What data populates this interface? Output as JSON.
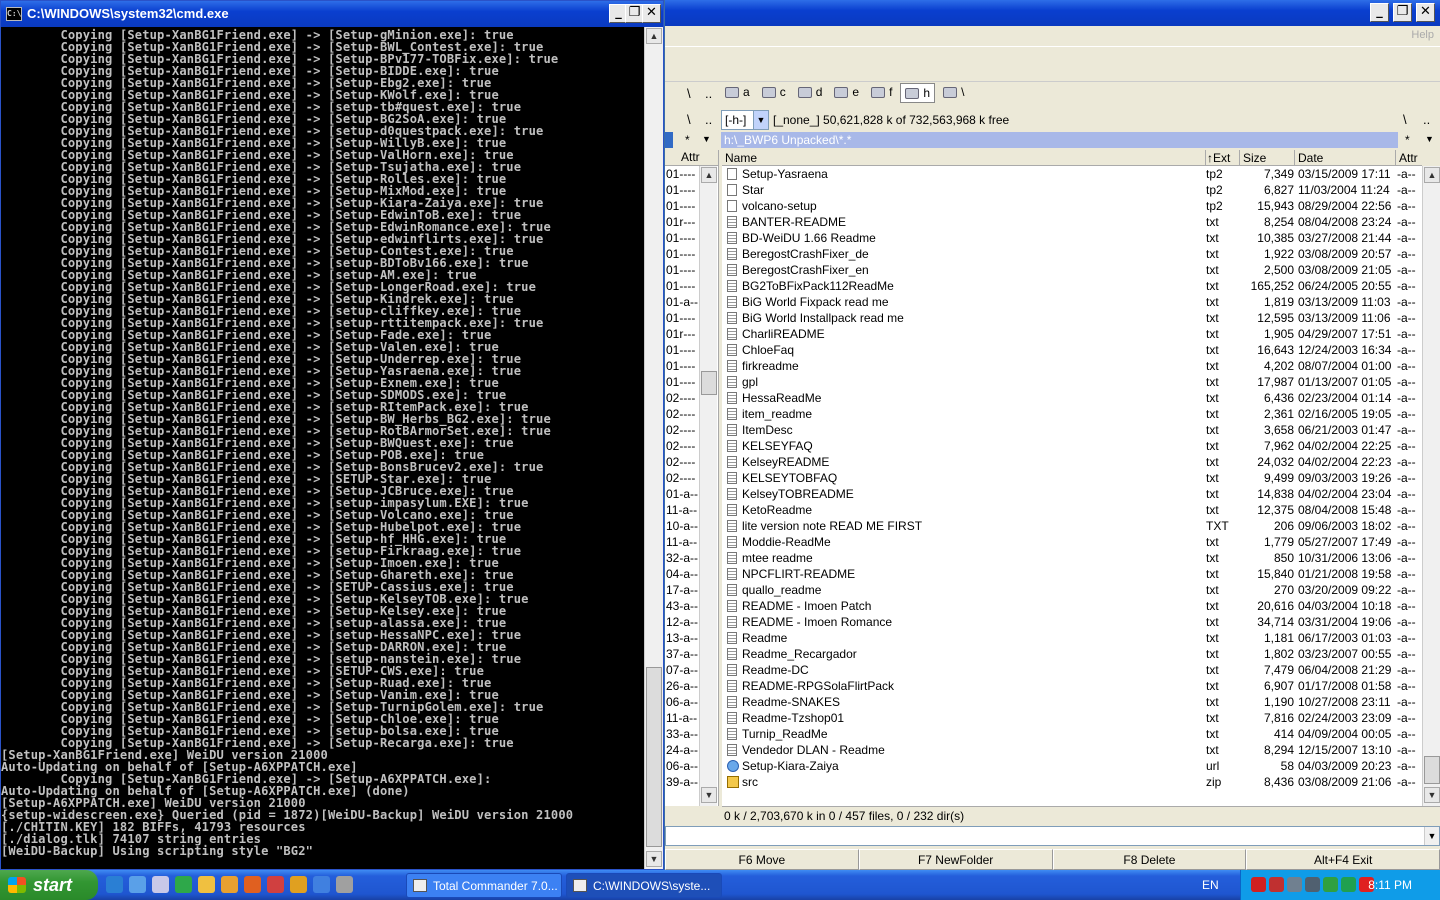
{
  "cmd": {
    "title": "C:\\WINDOWS\\system32\\cmd.exe",
    "lines": [
      "        Copying [Setup-XanBG1Friend.exe] -> [Setup-gMinion.exe]: true",
      "        Copying [Setup-XanBG1Friend.exe] -> [Setup-BWL_Contest.exe]: true",
      "        Copying [Setup-XanBG1Friend.exe] -> [Setup-BPv177-TOBFix.exe]: true",
      "        Copying [Setup-XanBG1Friend.exe] -> [Setup-BIDDE.exe]: true",
      "        Copying [Setup-XanBG1Friend.exe] -> [Setup-Ebg2.exe]: true",
      "        Copying [Setup-XanBG1Friend.exe] -> [Setup-KWolf.exe]: true",
      "        Copying [Setup-XanBG1Friend.exe] -> [setup-tb#quest.exe]: true",
      "        Copying [Setup-XanBG1Friend.exe] -> [Setup-BG2SoA.exe]: true",
      "        Copying [Setup-XanBG1Friend.exe] -> [setup-d0questpack.exe]: true",
      "        Copying [Setup-XanBG1Friend.exe] -> [Setup-WillyB.exe]: true",
      "        Copying [Setup-XanBG1Friend.exe] -> [Setup-ValHorn.exe]: true",
      "        Copying [Setup-XanBG1Friend.exe] -> [Setup-Tsujatha.exe]: true",
      "        Copying [Setup-XanBG1Friend.exe] -> [Setup-Rolles.exe]: true",
      "        Copying [Setup-XanBG1Friend.exe] -> [Setup-MixMod.exe]: true",
      "        Copying [Setup-XanBG1Friend.exe] -> [Setup-Kiara-Zaiya.exe]: true",
      "        Copying [Setup-XanBG1Friend.exe] -> [Setup-EdwinToB.exe]: true",
      "        Copying [Setup-XanBG1Friend.exe] -> [Setup-EdwinRomance.exe]: true",
      "        Copying [Setup-XanBG1Friend.exe] -> [Setup-edwinflirts.exe]: true",
      "        Copying [Setup-XanBG1Friend.exe] -> [Setup-Contest.exe]: true",
      "        Copying [Setup-XanBG1Friend.exe] -> [setup-BDToBv166.exe]: true",
      "        Copying [Setup-XanBG1Friend.exe] -> [setup-AM.exe]: true",
      "        Copying [Setup-XanBG1Friend.exe] -> [Setup-LongerRoad.exe]: true",
      "        Copying [Setup-XanBG1Friend.exe] -> [Setup-Kindrek.exe]: true",
      "        Copying [Setup-XanBG1Friend.exe] -> [setup-cliffkey.exe]: true",
      "        Copying [Setup-XanBG1Friend.exe] -> [setup-rttitempack.exe]: true",
      "        Copying [Setup-XanBG1Friend.exe] -> [Setup-Fade.exe]: true",
      "        Copying [Setup-XanBG1Friend.exe] -> [Setup-Valen.exe]: true",
      "        Copying [Setup-XanBG1Friend.exe] -> [Setup-Underrep.exe]: true",
      "        Copying [Setup-XanBG1Friend.exe] -> [Setup-Yasraena.exe]: true",
      "        Copying [Setup-XanBG1Friend.exe] -> [Setup-Exnem.exe]: true",
      "        Copying [Setup-XanBG1Friend.exe] -> [Setup-SDMODS.exe]: true",
      "        Copying [Setup-XanBG1Friend.exe] -> [setup-RItemPack.exe]: true",
      "        Copying [Setup-XanBG1Friend.exe] -> [Setup-BW_Herbs_BG2.exe]: true",
      "        Copying [Setup-XanBG1Friend.exe] -> [setup-RotBArmorSet.exe]: true",
      "        Copying [Setup-XanBG1Friend.exe] -> [Setup-BWQuest.exe]: true",
      "        Copying [Setup-XanBG1Friend.exe] -> [Setup-POB.exe]: true",
      "        Copying [Setup-XanBG1Friend.exe] -> [Setup-BonsBrucev2.exe]: true",
      "        Copying [Setup-XanBG1Friend.exe] -> [SETUP-Star.exe]: true",
      "        Copying [Setup-XanBG1Friend.exe] -> [Setup-JCBruce.exe]: true",
      "        Copying [Setup-XanBG1Friend.exe] -> [setup-impasylum.EXE]: true",
      "        Copying [Setup-XanBG1Friend.exe] -> [Setup-Volcano.exe]: true",
      "        Copying [Setup-XanBG1Friend.exe] -> [Setup-Hubelpot.exe]: true",
      "        Copying [Setup-XanBG1Friend.exe] -> [Setup-hf_HHG.exe]: true",
      "        Copying [Setup-XanBG1Friend.exe] -> [setup-Firkraag.exe]: true",
      "        Copying [Setup-XanBG1Friend.exe] -> [Setup-Imoen.exe]: true",
      "        Copying [Setup-XanBG1Friend.exe] -> [Setup-Ghareth.exe]: true",
      "        Copying [Setup-XanBG1Friend.exe] -> [SETUP-Cassius.exe]: true",
      "        Copying [Setup-XanBG1Friend.exe] -> [Setup-KelseyTOB.exe]: true",
      "        Copying [Setup-XanBG1Friend.exe] -> [Setup-Kelsey.exe]: true",
      "        Copying [Setup-XanBG1Friend.exe] -> [setup-alassa.exe]: true",
      "        Copying [Setup-XanBG1Friend.exe] -> [setup-HessaNPC.exe]: true",
      "        Copying [Setup-XanBG1Friend.exe] -> [Setup-DARRON.exe]: true",
      "        Copying [Setup-XanBG1Friend.exe] -> [setup-nanstein.exe]: true",
      "        Copying [Setup-XanBG1Friend.exe] -> [SETUP-CWS.exe]: true",
      "        Copying [Setup-XanBG1Friend.exe] -> [Setup-Ruad.exe]: true",
      "        Copying [Setup-XanBG1Friend.exe] -> [Setup-Vanim.exe]: true",
      "        Copying [Setup-XanBG1Friend.exe] -> [Setup-TurnipGolem.exe]: true",
      "        Copying [Setup-XanBG1Friend.exe] -> [Setup-Chloe.exe]: true",
      "        Copying [Setup-XanBG1Friend.exe] -> [setup-bolsa.exe]: true",
      "        Copying [Setup-XanBG1Friend.exe] -> [Setup-Recarga.exe]: true",
      "[Setup-XanBG1Friend.exe] WeiDU version 21000",
      "Auto-Updating on behalf of [Setup-A6XPPATCH.exe]",
      "        Copying [Setup-XanBG1Friend.exe] -> [Setup-A6XPPATCH.exe]:",
      "Auto-Updating on behalf of [Setup-A6XPPATCH.exe] (done)",
      "[Setup-A6XPPATCH.exe] WeiDU version 21000",
      "{setup-widescreen.exe} Queried (pid = 1872)[WeiDU-Backup] WeiDU version 21000",
      "[./CHITIN.KEY] 182 BIFFs, 41793 resources",
      "[./dialog.tlk] 74107 string entries",
      "[WeiDU-Backup] Using scripting style \"BG2\""
    ]
  },
  "tc": {
    "menu_help": "Help",
    "nav_root": "\\",
    "nav_up": "..",
    "drives": [
      {
        "label": "a",
        "icon": "floppy-drive-icon"
      },
      {
        "label": "c",
        "icon": "hard-drive-icon"
      },
      {
        "label": "d",
        "icon": "hard-drive-icon"
      },
      {
        "label": "e",
        "icon": "cd-drive-icon"
      },
      {
        "label": "f",
        "icon": "cd-drive-icon"
      },
      {
        "label": "h",
        "icon": "hard-drive-icon"
      },
      {
        "label": "\\",
        "icon": "network-icon"
      }
    ],
    "active_drive": "h",
    "drive_select": "[-h-]",
    "free_space": "[_none_]  50,621,828 k of 732,563,968 k free",
    "star": "*",
    "path": "h:\\_BWP6 Unpacked\\*.*",
    "left_header": "Attr",
    "left_rows": [
      "01----",
      "01----",
      "01----",
      "01r---",
      "01----",
      "01----",
      "01----",
      "01----",
      "01-a--",
      "01----",
      "01r---",
      "01----",
      "01----",
      "01----",
      "02----",
      "02----",
      "02----",
      "02----",
      "02----",
      "02----",
      "01-a--",
      "11-a--",
      "10-a--",
      "11-a--",
      "32-a--",
      "04-a--",
      "17-a--",
      "43-a--",
      "12-a--",
      "13-a--",
      "37-a--",
      "07-a--",
      "26-a--",
      "06-a--",
      "11-a--",
      "33-a--",
      "24-a--",
      "06-a--",
      "39-a--"
    ],
    "columns": {
      "name": "Name",
      "ext": "↑Ext",
      "size": "Size",
      "date": "Date",
      "attr": "Attr"
    },
    "files": [
      {
        "name": "Setup-Yasraena",
        "ext": "tp2",
        "size": "7,349",
        "date": "03/15/2009 17:11",
        "attr": "-a--",
        "icon": "file-icon"
      },
      {
        "name": "Star",
        "ext": "tp2",
        "size": "6,827",
        "date": "11/03/2004 11:24",
        "attr": "-a--",
        "icon": "file-icon"
      },
      {
        "name": "volcano-setup",
        "ext": "tp2",
        "size": "15,943",
        "date": "08/29/2004 22:56",
        "attr": "-a--",
        "icon": "file-icon"
      },
      {
        "name": "BANTER-README",
        "ext": "txt",
        "size": "8,254",
        "date": "08/04/2008 23:24",
        "attr": "-a--",
        "icon": "text-file-icon"
      },
      {
        "name": "BD-WeiDU 1.66 Readme",
        "ext": "txt",
        "size": "10,385",
        "date": "03/27/2008 21:44",
        "attr": "-a--",
        "icon": "text-file-icon"
      },
      {
        "name": "BeregostCrashFixer_de",
        "ext": "txt",
        "size": "1,922",
        "date": "03/08/2009 20:57",
        "attr": "-a--",
        "icon": "text-file-icon"
      },
      {
        "name": "BeregostCrashFixer_en",
        "ext": "txt",
        "size": "2,500",
        "date": "03/08/2009 21:05",
        "attr": "-a--",
        "icon": "text-file-icon"
      },
      {
        "name": "BG2ToBFixPack112ReadMe",
        "ext": "txt",
        "size": "165,252",
        "date": "06/24/2005 20:55",
        "attr": "-a--",
        "icon": "text-file-icon"
      },
      {
        "name": "BiG World Fixpack read me",
        "ext": "txt",
        "size": "1,819",
        "date": "03/13/2009 11:03",
        "attr": "-a--",
        "icon": "text-file-icon"
      },
      {
        "name": "BiG World Installpack read me",
        "ext": "txt",
        "size": "12,595",
        "date": "03/13/2009 11:06",
        "attr": "-a--",
        "icon": "text-file-icon"
      },
      {
        "name": "CharliREADME",
        "ext": "txt",
        "size": "1,905",
        "date": "04/29/2007 17:51",
        "attr": "-a--",
        "icon": "text-file-icon"
      },
      {
        "name": "ChloeFaq",
        "ext": "txt",
        "size": "16,643",
        "date": "12/24/2003 16:34",
        "attr": "-a--",
        "icon": "text-file-icon"
      },
      {
        "name": "firkreadme",
        "ext": "txt",
        "size": "4,202",
        "date": "08/07/2004 01:00",
        "attr": "-a--",
        "icon": "text-file-icon"
      },
      {
        "name": "gpl",
        "ext": "txt",
        "size": "17,987",
        "date": "01/13/2007 01:05",
        "attr": "-a--",
        "icon": "text-file-icon"
      },
      {
        "name": "HessaReadMe",
        "ext": "txt",
        "size": "6,436",
        "date": "02/23/2004 01:14",
        "attr": "-a--",
        "icon": "text-file-icon"
      },
      {
        "name": "item_readme",
        "ext": "txt",
        "size": "2,361",
        "date": "02/16/2005 19:05",
        "attr": "-a--",
        "icon": "text-file-icon"
      },
      {
        "name": "ItemDesc",
        "ext": "txt",
        "size": "3,658",
        "date": "06/21/2003 01:47",
        "attr": "-a--",
        "icon": "text-file-icon"
      },
      {
        "name": "KELSEYFAQ",
        "ext": "txt",
        "size": "7,962",
        "date": "04/02/2004 22:25",
        "attr": "-a--",
        "icon": "text-file-icon"
      },
      {
        "name": "KelseyREADME",
        "ext": "txt",
        "size": "24,032",
        "date": "04/02/2004 22:23",
        "attr": "-a--",
        "icon": "text-file-icon"
      },
      {
        "name": "KELSEYTOBFAQ",
        "ext": "txt",
        "size": "9,499",
        "date": "09/03/2003 19:26",
        "attr": "-a--",
        "icon": "text-file-icon"
      },
      {
        "name": "KelseyTOBREADME",
        "ext": "txt",
        "size": "14,838",
        "date": "04/02/2004 23:04",
        "attr": "-a--",
        "icon": "text-file-icon"
      },
      {
        "name": "KetoReadme",
        "ext": "txt",
        "size": "12,375",
        "date": "08/04/2008 15:48",
        "attr": "-a--",
        "icon": "text-file-icon"
      },
      {
        "name": "lite version note READ ME FIRST",
        "ext": "TXT",
        "size": "206",
        "date": "09/06/2003 18:02",
        "attr": "-a--",
        "icon": "text-file-icon"
      },
      {
        "name": "Moddie-ReadMe",
        "ext": "txt",
        "size": "1,779",
        "date": "05/27/2007 17:49",
        "attr": "-a--",
        "icon": "text-file-icon"
      },
      {
        "name": "mtee readme",
        "ext": "txt",
        "size": "850",
        "date": "10/31/2006 13:06",
        "attr": "-a--",
        "icon": "text-file-icon"
      },
      {
        "name": "NPCFLIRT-README",
        "ext": "txt",
        "size": "15,840",
        "date": "01/21/2008 19:58",
        "attr": "-a--",
        "icon": "text-file-icon"
      },
      {
        "name": "quallo_readme",
        "ext": "txt",
        "size": "270",
        "date": "03/20/2009 09:22",
        "attr": "-a--",
        "icon": "text-file-icon"
      },
      {
        "name": "README - Imoen Patch",
        "ext": "txt",
        "size": "20,616",
        "date": "04/03/2004 10:18",
        "attr": "-a--",
        "icon": "text-file-icon"
      },
      {
        "name": "README - Imoen Romance",
        "ext": "txt",
        "size": "34,714",
        "date": "03/31/2004 19:06",
        "attr": "-a--",
        "icon": "text-file-icon"
      },
      {
        "name": "Readme",
        "ext": "txt",
        "size": "1,181",
        "date": "06/17/2003 01:03",
        "attr": "-a--",
        "icon": "text-file-icon"
      },
      {
        "name": "Readme_Recargador",
        "ext": "txt",
        "size": "1,802",
        "date": "03/23/2007 00:55",
        "attr": "-a--",
        "icon": "text-file-icon"
      },
      {
        "name": "Readme-DC",
        "ext": "txt",
        "size": "7,479",
        "date": "06/04/2008 21:29",
        "attr": "-a--",
        "icon": "text-file-icon"
      },
      {
        "name": "README-RPGSolaFlirtPack",
        "ext": "txt",
        "size": "6,907",
        "date": "01/17/2008 01:58",
        "attr": "-a--",
        "icon": "text-file-icon"
      },
      {
        "name": "Readme-SNAKES",
        "ext": "txt",
        "size": "1,190",
        "date": "10/27/2008 23:11",
        "attr": "-a--",
        "icon": "text-file-icon"
      },
      {
        "name": "Readme-Tzshop01",
        "ext": "txt",
        "size": "7,816",
        "date": "02/24/2003 23:09",
        "attr": "-a--",
        "icon": "text-file-icon"
      },
      {
        "name": "Turnip_ReadMe",
        "ext": "txt",
        "size": "414",
        "date": "04/09/2004 00:05",
        "attr": "-a--",
        "icon": "text-file-icon"
      },
      {
        "name": "Vendedor DLAN - Readme",
        "ext": "txt",
        "size": "8,294",
        "date": "12/15/2007 13:10",
        "attr": "-a--",
        "icon": "text-file-icon"
      },
      {
        "name": "Setup-Kiara-Zaiya",
        "ext": "url",
        "size": "58",
        "date": "04/03/2009 20:23",
        "attr": "-a--",
        "icon": "internet-shortcut-icon"
      },
      {
        "name": "src",
        "ext": "zip",
        "size": "8,436",
        "date": "03/08/2009 21:06",
        "attr": "-a--",
        "icon": "zip-archive-icon"
      }
    ],
    "status": "0 k / 2,703,670 k in 0 / 457 files, 0 / 232 dir(s)",
    "fkeys": [
      "F6 Move",
      "F7 NewFolder",
      "F8 Delete",
      "Alt+F4 Exit"
    ]
  },
  "taskbar": {
    "start_label": "start",
    "tasks": [
      {
        "label": "Total Commander 7.0...",
        "active": false
      },
      {
        "label": "C:\\WINDOWS\\syste...",
        "active": true
      }
    ],
    "language": "EN",
    "clock": "8:11 PM"
  },
  "colors": {
    "titlebar": "#0a3fcf",
    "cmd_bg": "#000000",
    "cmd_text": "#c0c0c0",
    "path_bar": "#a8b8e8",
    "taskbar": "#245edb",
    "start": "#329632",
    "tray": "#0f9ce8"
  }
}
